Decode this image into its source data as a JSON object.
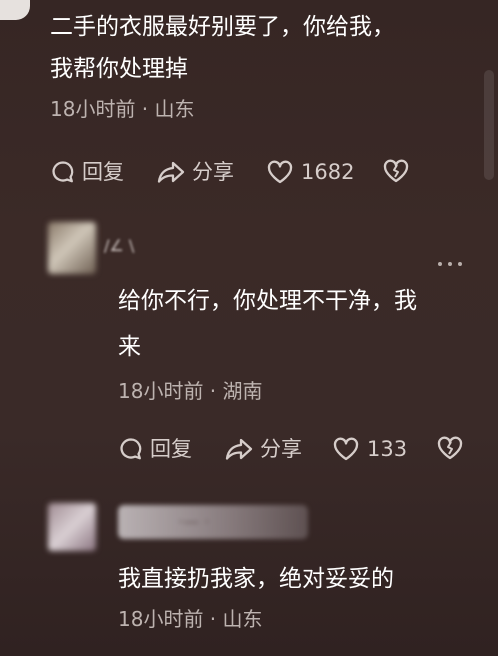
{
  "comments": [
    {
      "text_line1": "二手的衣服最好别要了，你给我，",
      "text_line2": "我帮你处理掉",
      "meta": "18小时前 · 山东",
      "reply_label": "回复",
      "share_label": "分享",
      "likes": "1682"
    },
    {
      "username": "/∠ \\",
      "text_line1": "给你不行，你处理不干净，我",
      "text_line2": "来",
      "meta": "18小时前 · 湖南",
      "reply_label": "回复",
      "share_label": "分享",
      "likes": "133",
      "more_icon": "more-dots-icon"
    },
    {
      "username": "·— ·",
      "text_line1": "我直接扔我家，绝对妥妥的",
      "meta": "18小时前 · 山东"
    }
  ],
  "icons": [
    "comment-bubble-icon",
    "share-arrow-icon",
    "heart-icon",
    "broken-heart-icon",
    "more-dots-icon"
  ],
  "colors": {
    "background": "#3a2a28",
    "text": "#ffffff",
    "meta": "#bdb3b0",
    "action": "#d6cdca"
  }
}
